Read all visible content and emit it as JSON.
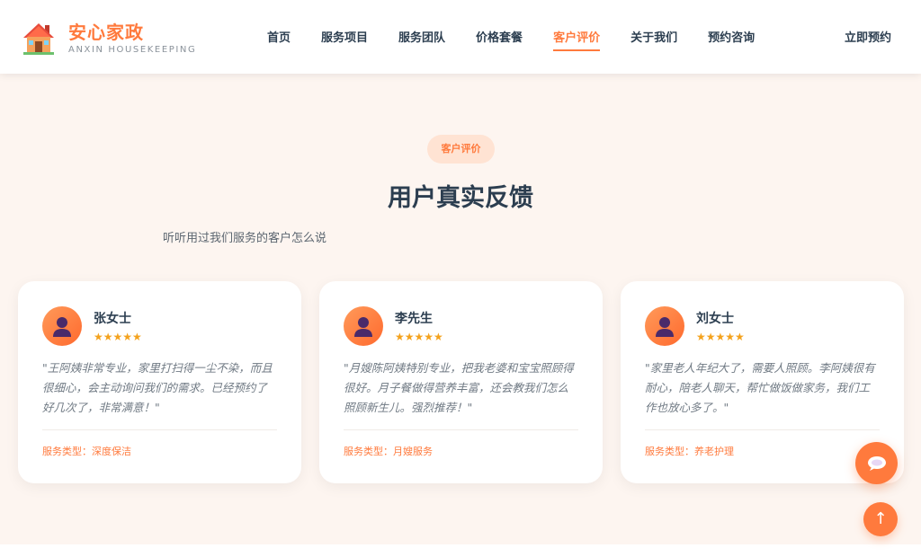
{
  "brand": {
    "name": "安心家政",
    "subtitle": "ANXIN HOUSEKEEPING"
  },
  "nav": {
    "items": [
      {
        "label": "首页"
      },
      {
        "label": "服务项目"
      },
      {
        "label": "服务团队"
      },
      {
        "label": "价格套餐"
      },
      {
        "label": "客户评价"
      },
      {
        "label": "关于我们"
      },
      {
        "label": "预约咨询"
      }
    ],
    "active_index": 4,
    "book_label": "立即预约"
  },
  "section": {
    "badge": "客户评价",
    "title": "用户真实反馈",
    "subtitle": "听听用过我们服务的客户怎么说"
  },
  "reviews": [
    {
      "name": "张女士",
      "stars": "★★★★★",
      "rating": 5,
      "text": "\"王阿姨非常专业，家里打扫得一尘不染，而且很细心，会主动询问我们的需求。已经预约了好几次了，非常满意！\"",
      "service": "服务类型：深度保洁"
    },
    {
      "name": "李先生",
      "stars": "★★★★★",
      "rating": 5,
      "text": "\"月嫂陈阿姨特别专业，把我老婆和宝宝照顾得很好。月子餐做得营养丰富，还会教我们怎么照顾新生儿。强烈推荐！\"",
      "service": "服务类型：月嫂服务"
    },
    {
      "name": "刘女士",
      "stars": "★★★★★",
      "rating": 5,
      "text": "\"家里老人年纪大了，需要人照顾。李阿姨很有耐心，陪老人聊天，帮忙做饭做家务，我们工作也放心多了。\"",
      "service": "服务类型：养老护理"
    }
  ],
  "floating": {
    "chat_icon": "chat-bubble-icon",
    "top_icon": "arrow-up-icon",
    "top_glyph": "↑"
  },
  "colors": {
    "accent": "#ff7a3d",
    "section_bg": "#fdf5f0",
    "badge_bg": "#ffe3d3",
    "star": "#f4a21d",
    "heading": "#2c3e50"
  }
}
